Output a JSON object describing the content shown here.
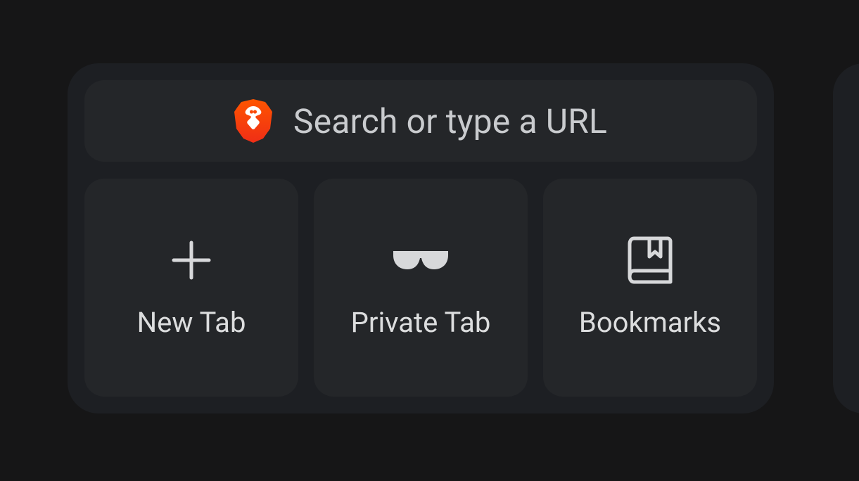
{
  "search": {
    "placeholder": "Search or type a URL"
  },
  "shortcuts": {
    "new_tab": {
      "label": "New Tab"
    },
    "private_tab": {
      "label": "Private Tab"
    },
    "bookmarks": {
      "label": "Bookmarks"
    }
  }
}
